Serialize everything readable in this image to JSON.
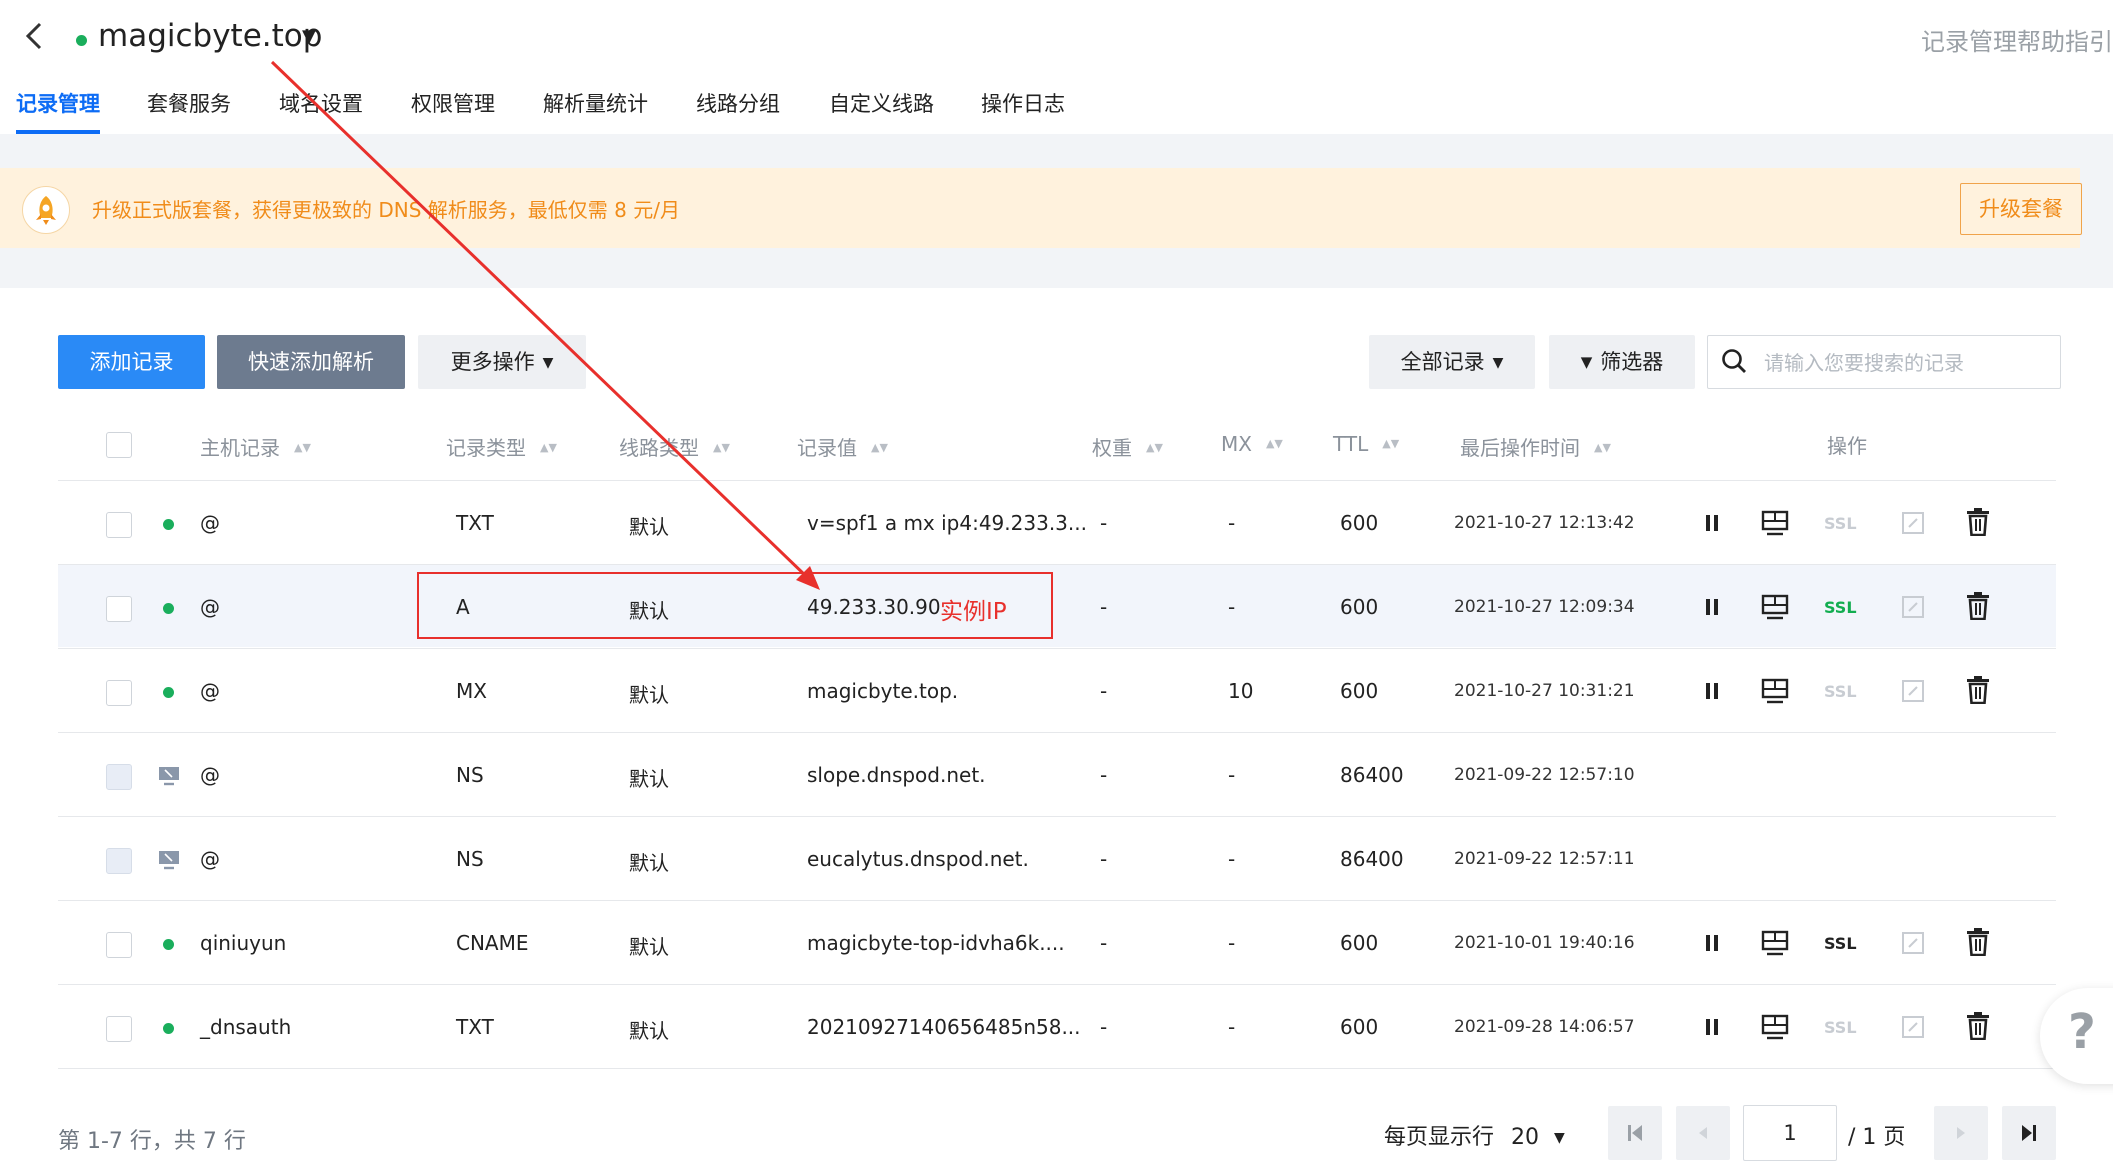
{
  "header": {
    "domain": "magicbyte.top",
    "help_link": "记录管理帮助指引"
  },
  "tabs": [
    "记录管理",
    "套餐服务",
    "域名设置",
    "权限管理",
    "解析量统计",
    "线路分组",
    "自定义线路",
    "操作日志"
  ],
  "banner": {
    "text": "升级正式版套餐，获得更极致的 DNS 解析服务，最低仅需 8 元/月",
    "button": "升级套餐"
  },
  "toolbar": {
    "add": "添加记录",
    "quick_add": "快速添加解析",
    "more": "更多操作",
    "all_records": "全部记录",
    "filter": "筛选器",
    "search_placeholder": "请输入您要搜索的记录"
  },
  "columns": {
    "host": "主机记录",
    "type": "记录类型",
    "line": "线路类型",
    "value": "记录值",
    "weight": "权重",
    "mx": "MX",
    "ttl": "TTL",
    "time": "最后操作时间",
    "actions": "操作"
  },
  "rows": [
    {
      "status": "enabled",
      "host": "@",
      "type": "TXT",
      "line": "默认",
      "value": "v=spf1 a mx ip4:49.233.3...",
      "weight": "-",
      "mx": "-",
      "ttl": "600",
      "time": "2021-10-27 12:13:42",
      "ssl": "off"
    },
    {
      "status": "enabled",
      "host": "@",
      "type": "A",
      "line": "默认",
      "value": "49.233.30.90",
      "weight": "-",
      "mx": "-",
      "ttl": "600",
      "time": "2021-10-27 12:09:34",
      "ssl": "green"
    },
    {
      "status": "enabled",
      "host": "@",
      "type": "MX",
      "line": "默认",
      "value": "magicbyte.top.",
      "weight": "-",
      "mx": "10",
      "ttl": "600",
      "time": "2021-10-27 10:31:21",
      "ssl": "off"
    },
    {
      "status": "system",
      "host": "@",
      "type": "NS",
      "line": "默认",
      "value": "slope.dnspod.net.",
      "weight": "-",
      "mx": "-",
      "ttl": "86400",
      "time": "2021-09-22 12:57:10",
      "ssl": "none"
    },
    {
      "status": "system",
      "host": "@",
      "type": "NS",
      "line": "默认",
      "value": "eucalytus.dnspod.net.",
      "weight": "-",
      "mx": "-",
      "ttl": "86400",
      "time": "2021-09-22 12:57:11",
      "ssl": "none"
    },
    {
      "status": "enabled",
      "host": "qiniuyun",
      "type": "CNAME",
      "line": "默认",
      "value": "magicbyte-top-idvha6k....",
      "weight": "-",
      "mx": "-",
      "ttl": "600",
      "time": "2021-10-01 19:40:16",
      "ssl": "black"
    },
    {
      "status": "enabled",
      "host": "_dnsauth",
      "type": "TXT",
      "line": "默认",
      "value": "20210927140656485n58...",
      "weight": "-",
      "mx": "-",
      "ttl": "600",
      "time": "2021-09-28 14:06:57",
      "ssl": "off"
    }
  ],
  "ssl_label": "SSL",
  "annotation": "实例IP",
  "footer": {
    "summary": "第 1-7 行，共 7 行",
    "page_size_label": "每页显示行",
    "page_size": "20",
    "current_page": "1",
    "total_pages": "/ 1 页"
  },
  "help_fab": "?",
  "colors": {
    "primary": "#2a8af6",
    "active_tab": "#0d6cf5",
    "banner_text": "#f08c1a",
    "annotation": "#e8302c",
    "status_green": "#1aae5c",
    "ssl_green": "#12ad50"
  }
}
